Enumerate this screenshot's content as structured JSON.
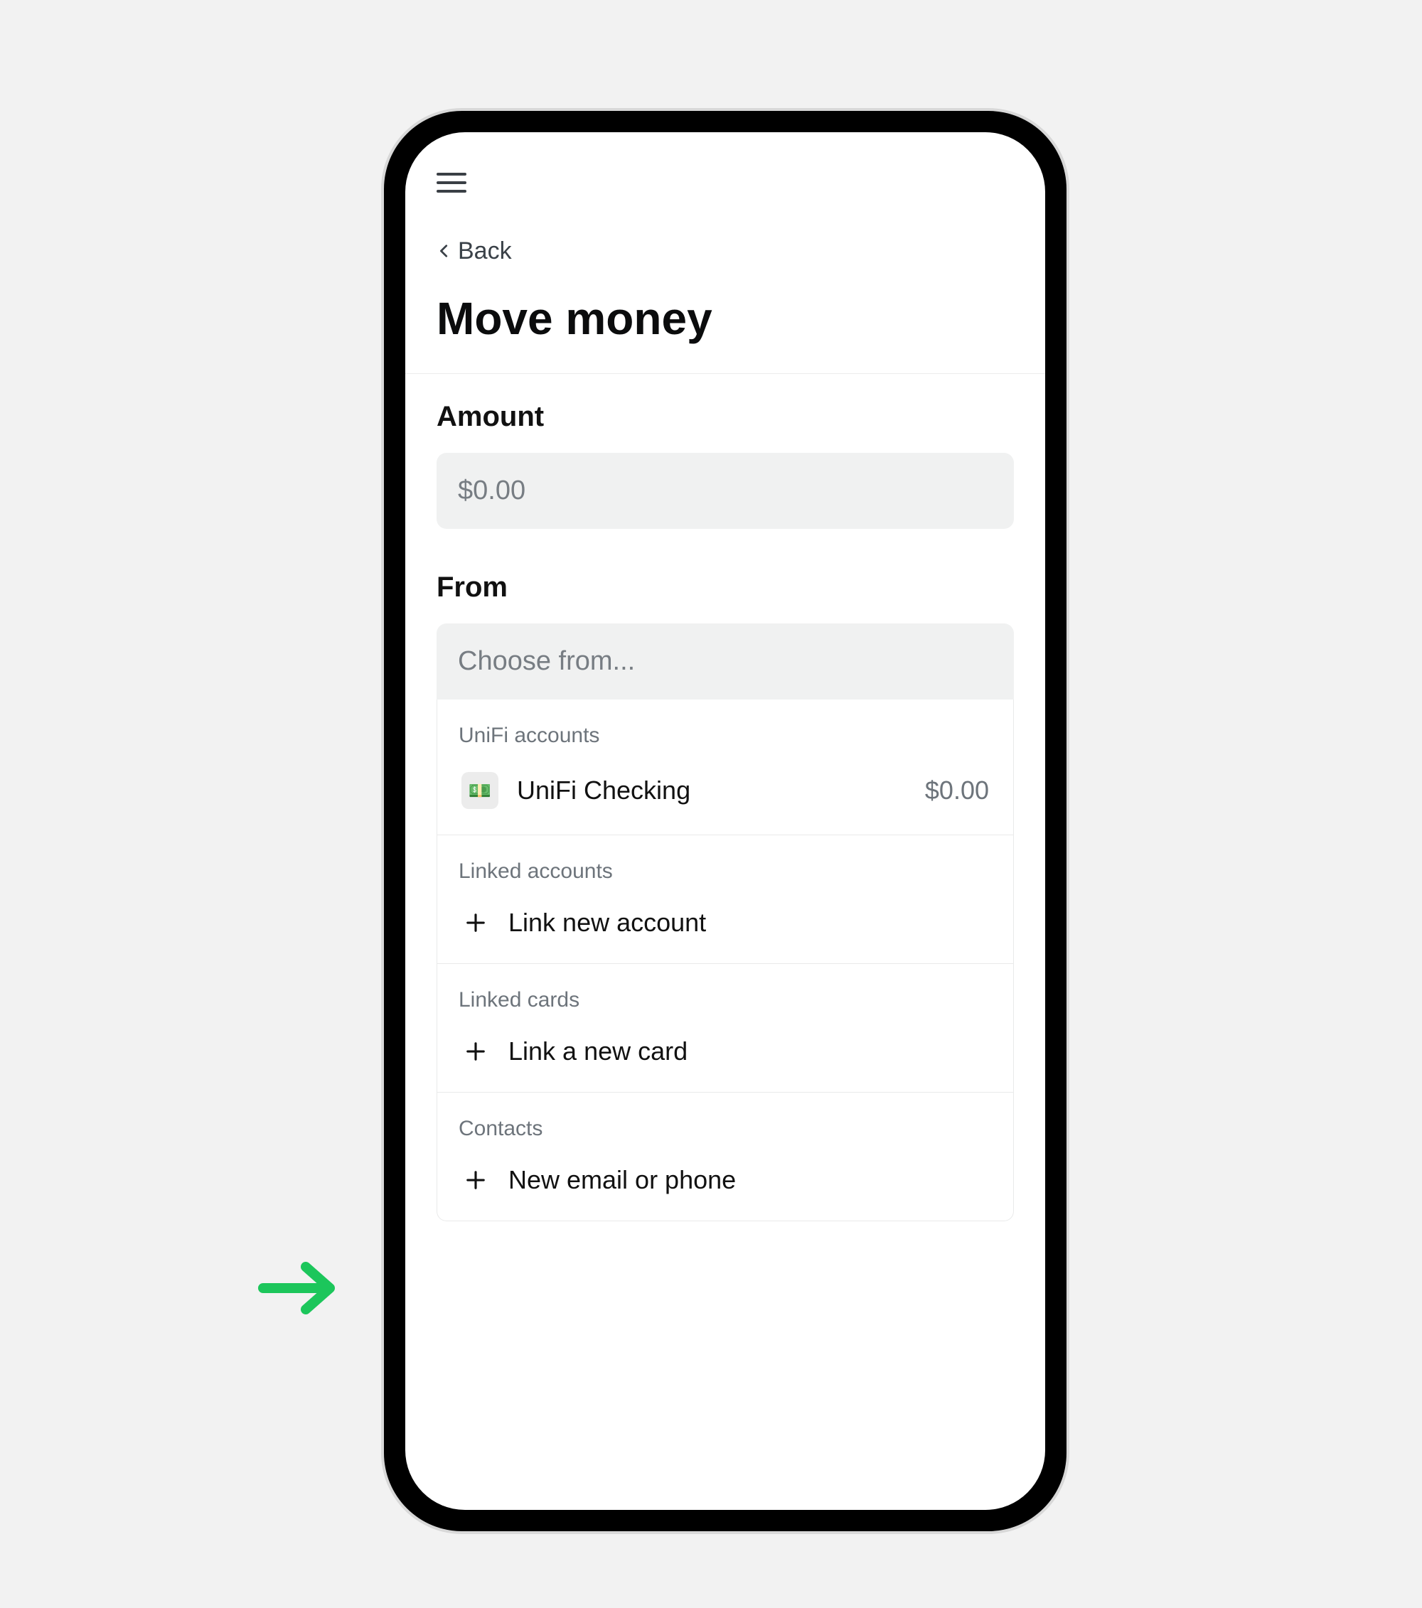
{
  "header": {
    "back_label": "Back",
    "page_title": "Move money"
  },
  "amount": {
    "label": "Amount",
    "placeholder": "$0.00"
  },
  "from": {
    "label": "From",
    "placeholder": "Choose from..."
  },
  "dropdown": {
    "groups": [
      {
        "title": "UniFi accounts",
        "items": [
          {
            "icon": "money-emoji",
            "label": "UniFi Checking",
            "amount": "$0.00"
          }
        ]
      },
      {
        "title": "Linked accounts",
        "items": [
          {
            "icon": "plus",
            "label": "Link new account"
          }
        ]
      },
      {
        "title": "Linked cards",
        "items": [
          {
            "icon": "plus",
            "label": "Link a new card"
          }
        ]
      },
      {
        "title": "Contacts",
        "items": [
          {
            "icon": "plus",
            "label": "New email or phone"
          }
        ]
      }
    ]
  },
  "annotation": {
    "arrow_color": "#1cc65b"
  }
}
